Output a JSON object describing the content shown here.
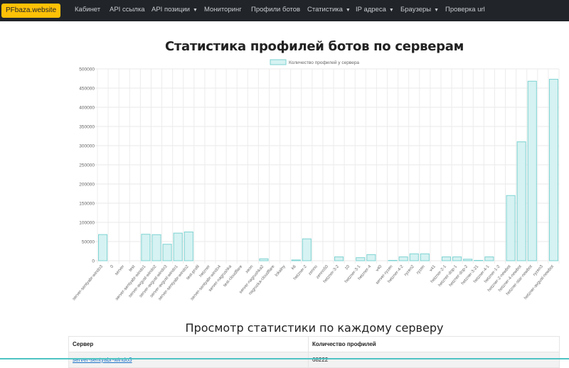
{
  "navbar": {
    "brand": "PFbaza.website",
    "items": [
      {
        "label": "Кабинет",
        "dropdown": false
      },
      {
        "label": "API ссылка",
        "dropdown": false
      },
      {
        "label": "API позиции",
        "dropdown": true
      },
      {
        "label": "Мониторинг",
        "dropdown": false
      },
      {
        "label": "Профили ботов",
        "dropdown": false
      },
      {
        "label": "Статистика",
        "dropdown": true
      },
      {
        "label": "IP адреса",
        "dropdown": true
      },
      {
        "label": "Браузеры",
        "dropdown": true
      },
      {
        "label": "Проверка url",
        "dropdown": false
      }
    ]
  },
  "section_title": "Просмотр статистики по каждому серверу",
  "table": {
    "headers": [
      "Сервер",
      "Количество профилей"
    ],
    "rows": [
      [
        "server-sentyabr-windo3",
        "68222"
      ]
    ]
  },
  "chart_data": {
    "type": "bar",
    "title": "Статистика профилей ботов по серверам",
    "legend": "Количество профилей у сервера",
    "legend_position": "top",
    "ylim": [
      0,
      500000
    ],
    "yticks": [
      0,
      50000,
      100000,
      150000,
      200000,
      250000,
      300000,
      350000,
      400000,
      450000,
      500000
    ],
    "grid": true,
    "bar_fill": "#d6f2f2",
    "bar_stroke": "#7fd3d3",
    "categories": [
      "server-sentyabr-windo3",
      "0",
      "server",
      "test",
      "server-sentyabr-windo1",
      "server-avgust-windo2",
      "server-avgust-windo3",
      "server-avgust-windo1",
      "server-sentyabr-windo2",
      "test-profil",
      "hetzner",
      "server-sentyabr-windo4",
      "server-nagrushka",
      "test-cloudflare",
      "xeon",
      "server-nagrushka2",
      "nagruzka-cloudflare",
      "lokalny",
      "k6",
      "hetzner-2",
      "zenno",
      "zenno50",
      "hetzner-3-2",
      "10",
      "hetzner-3-1",
      "hetzner-4",
      "v40",
      "server-ryzen",
      "hetzner-4-2",
      "ryzen2",
      "ryzen",
      "v41",
      "hetzner-2-1",
      "hetzner-dop-1",
      "hetzner-dop-2",
      "hetzner-3-21",
      "hetzner-4-1",
      "hetzner-1-2",
      "hetzner-2-newbot",
      "hetzner-4-newbot",
      "hetzner-star-newbot",
      "ryzen3",
      "hetzner-avgust-newbot"
    ],
    "values": [
      68222,
      0,
      0,
      0,
      69000,
      68000,
      43000,
      72000,
      75000,
      0,
      0,
      0,
      0,
      0,
      0,
      5000,
      0,
      0,
      2000,
      57000,
      0,
      0,
      10000,
      0,
      8000,
      16000,
      0,
      1000,
      10000,
      18000,
      18000,
      0,
      10000,
      10000,
      4000,
      1000,
      10000,
      0,
      170000,
      310000,
      468000,
      0,
      473000
    ]
  }
}
